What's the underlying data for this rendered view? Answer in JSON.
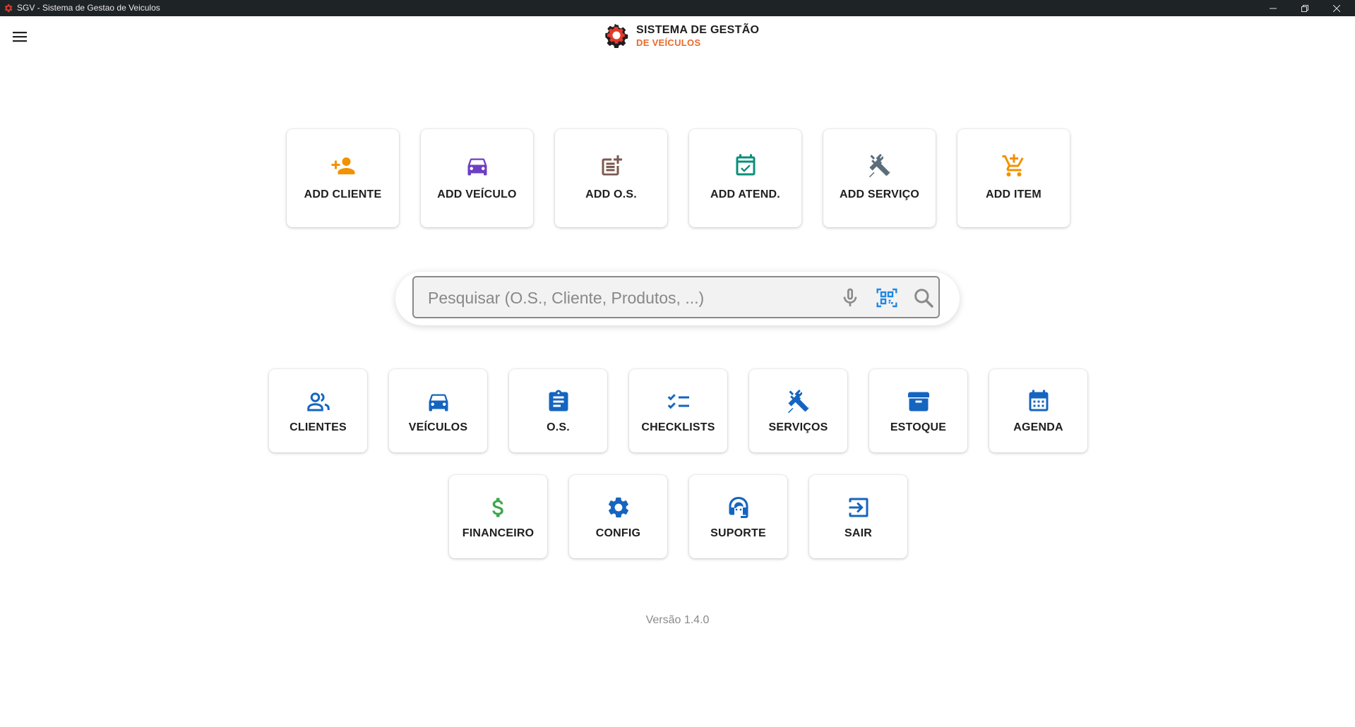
{
  "window": {
    "title": "SGV - Sistema de Gestao de Veiculos"
  },
  "brand": {
    "line1": "SISTEMA DE GESTÃO",
    "line2": "DE VEÍCULOS",
    "accent": "#e86a2c"
  },
  "quick_actions": [
    {
      "label": "ADD CLIENTE",
      "icon": "person-add-icon",
      "color": "#f29200"
    },
    {
      "label": "ADD VEÍCULO",
      "icon": "car-icon",
      "color": "#6c3fc4"
    },
    {
      "label": "ADD O.S.",
      "icon": "note-add-icon",
      "color": "#7a5a4f"
    },
    {
      "label": "ADD ATEND.",
      "icon": "calendar-check-icon",
      "color": "#0a8f7a"
    },
    {
      "label": "ADD SERVIÇO",
      "icon": "tools-icon",
      "color": "#5b6e7a"
    },
    {
      "label": "ADD ITEM",
      "icon": "cart-add-icon",
      "color": "#f29200"
    }
  ],
  "search": {
    "placeholder": "Pesquisar (O.S., Cliente, Produtos, ...)"
  },
  "nav_row1": [
    {
      "label": "CLIENTES",
      "icon": "people-icon",
      "color": "#1565c0"
    },
    {
      "label": "VEÍCULOS",
      "icon": "car-icon",
      "color": "#1565c0"
    },
    {
      "label": "O.S.",
      "icon": "clipboard-icon",
      "color": "#1565c0"
    },
    {
      "label": "CHECKLISTS",
      "icon": "checklist-icon",
      "color": "#1565c0"
    },
    {
      "label": "SERVIÇOS",
      "icon": "tools-icon",
      "color": "#1565c0"
    },
    {
      "label": "ESTOQUE",
      "icon": "archive-icon",
      "color": "#1565c0"
    },
    {
      "label": "AGENDA",
      "icon": "calendar-icon",
      "color": "#1565c0"
    }
  ],
  "nav_row2": [
    {
      "label": "FINANCEIRO",
      "icon": "dollar-icon",
      "color": "#3aa64a"
    },
    {
      "label": "CONFIG",
      "icon": "gear-icon",
      "color": "#1565c0"
    },
    {
      "label": "SUPORTE",
      "icon": "headset-icon",
      "color": "#1565c0"
    },
    {
      "label": "SAIR",
      "icon": "logout-icon",
      "color": "#1565c0"
    }
  ],
  "footer": {
    "version": "Versão 1.4.0"
  }
}
